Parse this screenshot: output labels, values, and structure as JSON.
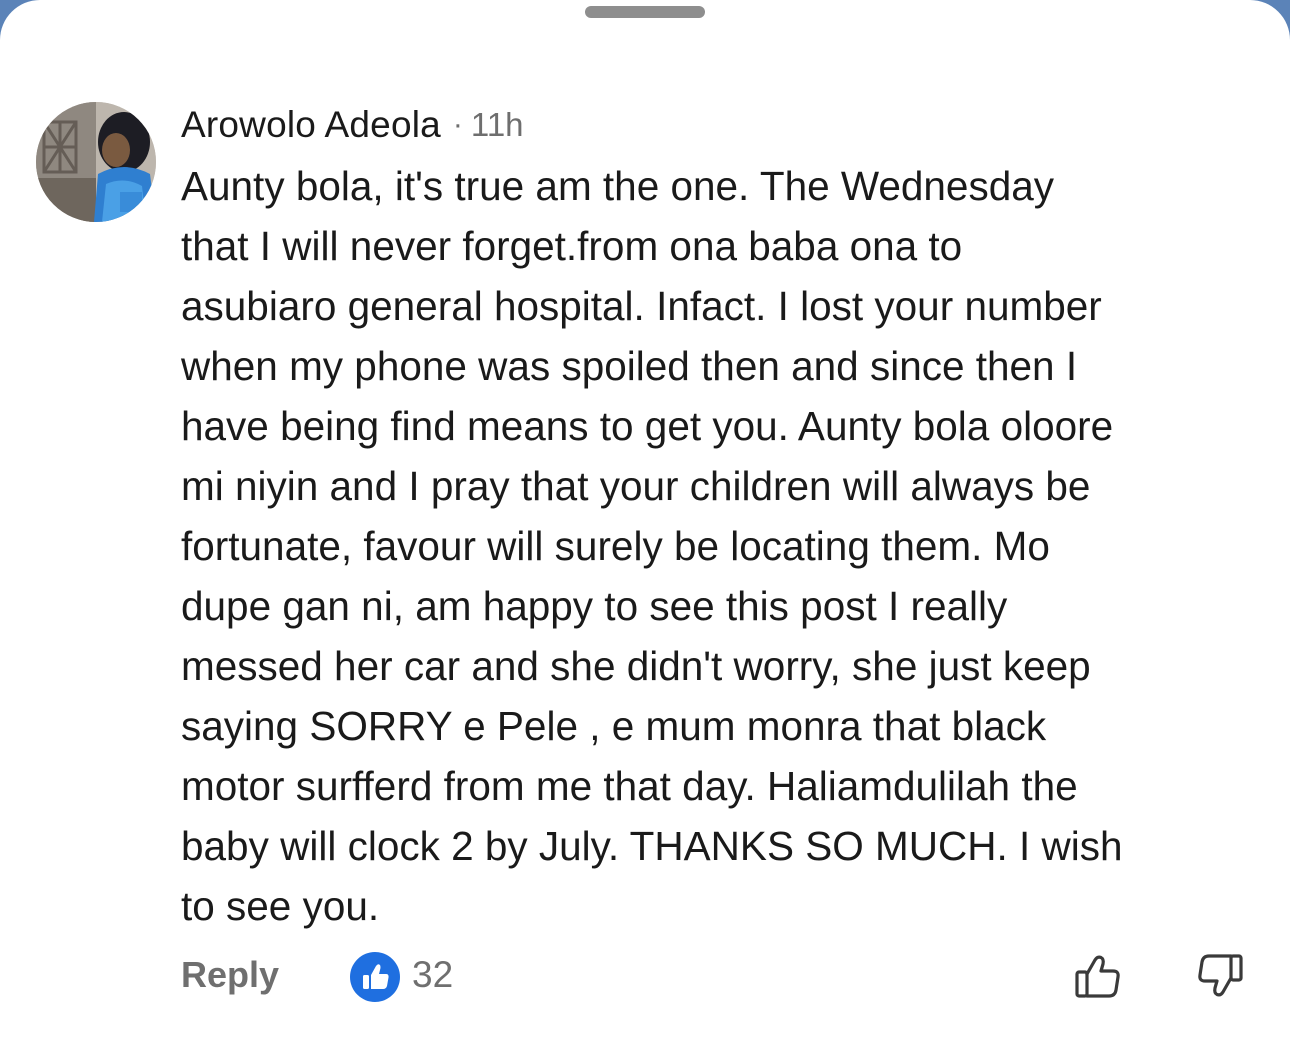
{
  "comment": {
    "author": "Arowolo Adeola",
    "separator": "·",
    "time": "11h",
    "text": "Aunty bola, it's true am the one. The Wednesday\nthat I will never forget.from ona baba ona to\nasubiaro general hospital. Infact. I lost your number\nwhen my phone was spoiled then and since then I\nhave being find means to get you. Aunty bola oloore\nmi niyin and I pray that your children will always be\nfortunate, favour will surely be locating them. Mo\ndupe gan ni, am happy to see this post I really\nmessed her car and she didn't worry, she just keep\nsaying SORRY e Pele , e mum monra that black\nmotor surfferd from me that day. Haliamdulilah the\nbaby will clock 2 by July. THANKS SO MUCH. I wish\nto see you."
  },
  "actions": {
    "reply_label": "Reply",
    "like_count": "32"
  },
  "icons": {
    "avatar": "avatar",
    "like_badge": "thumbs-up-icon",
    "like": "thumbs-up-outline-icon",
    "dislike": "thumbs-down-outline-icon"
  },
  "colors": {
    "like_badge": "#1f6fe0",
    "muted_text": "#6f6f6f",
    "primary_text": "#1a1a1a"
  }
}
